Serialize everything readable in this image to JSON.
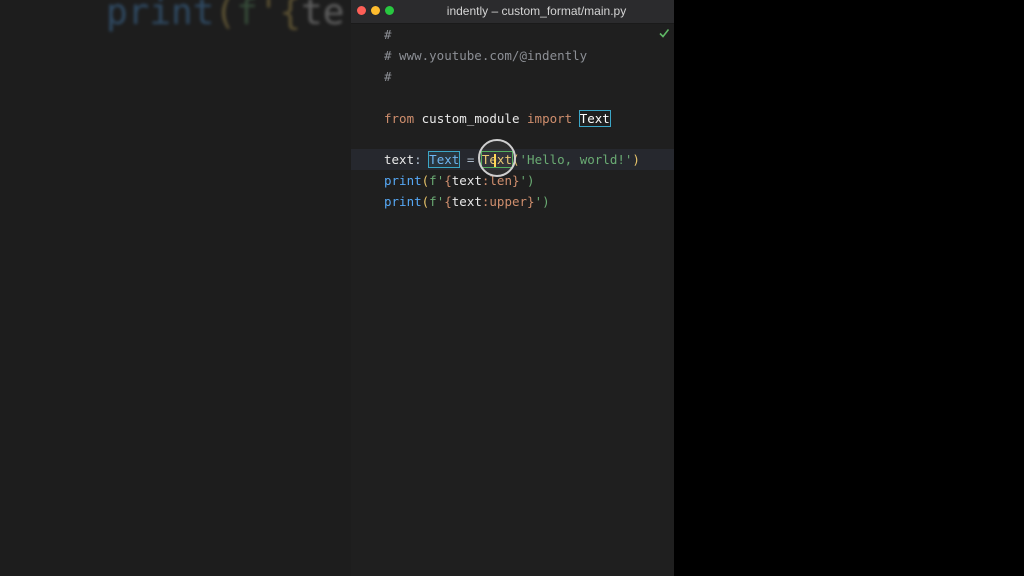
{
  "background": {
    "code_preview": [
      "print",
      "(",
      "f",
      "'{",
      "te"
    ]
  },
  "window": {
    "title": "indently – custom_format/main.py",
    "status_icon": "checkmark-icon"
  },
  "editor": {
    "lines": {
      "l1": "#",
      "l2": "# www.youtube.com/@indently",
      "l3": "#",
      "l4_from": "from",
      "l4_module": "custom_module",
      "l4_import": "import",
      "l4_name": "Text",
      "l5_var": "text",
      "l5_colon": ":",
      "l5_type": "Text",
      "l5_eq": "=",
      "l5_call": "Text",
      "l5_open": "(",
      "l5_arg": "'Hello, world!'",
      "l5_close": ")",
      "l6_fn": "print",
      "l6_open": "(",
      "l6_f": "f'",
      "l6_lb": "{",
      "l6_var": "text",
      "l6_fmt": ":len",
      "l6_rb": "}",
      "l6_end": "')",
      "l7_fn": "print",
      "l7_open": "(",
      "l7_f": "f'",
      "l7_lb": "{",
      "l7_var": "text",
      "l7_fmt": ":upper",
      "l7_rb": "}",
      "l7_end": "')"
    }
  },
  "colors": {
    "comment": "#8c8f95",
    "keyword": "#cf8e6d",
    "function": "#56a8f5",
    "string": "#6aab73",
    "selection_box": "#3ba6c7",
    "cursor": "#ffd64a"
  }
}
